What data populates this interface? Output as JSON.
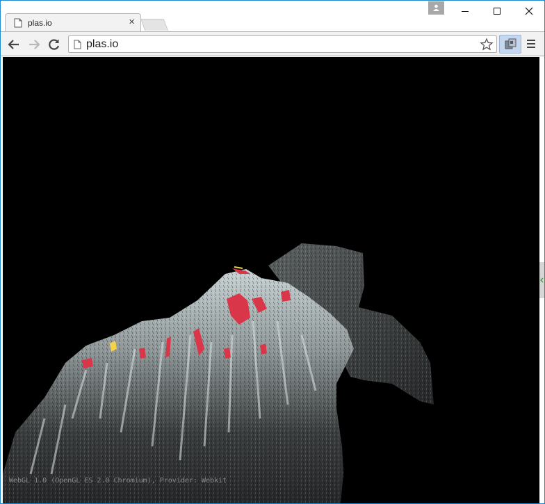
{
  "tab": {
    "title": "plas.io",
    "close_glyph": "×"
  },
  "address_bar": {
    "url": "plas.io"
  },
  "viewport": {
    "info_text": "WebGL 1.0 (OpenGL ES 2.0 Chromium), Provider: Webkit",
    "background": "#000000"
  },
  "icons": {
    "favicon": "page-icon",
    "back": "arrow-left-icon",
    "forward": "arrow-right-icon",
    "reload": "reload-icon",
    "bookmark": "star-icon",
    "extension": "extension-icon",
    "menu": "hamburger-menu-icon",
    "profile": "person-icon",
    "minimize": "minimize-icon",
    "maximize": "maximize-icon",
    "close": "close-icon"
  },
  "colors": {
    "window_border": "#1b8ad1",
    "toolbar": "#f2f2f2",
    "highlight_red": "#d9364a",
    "highlight_yellow": "#f3d34a"
  }
}
